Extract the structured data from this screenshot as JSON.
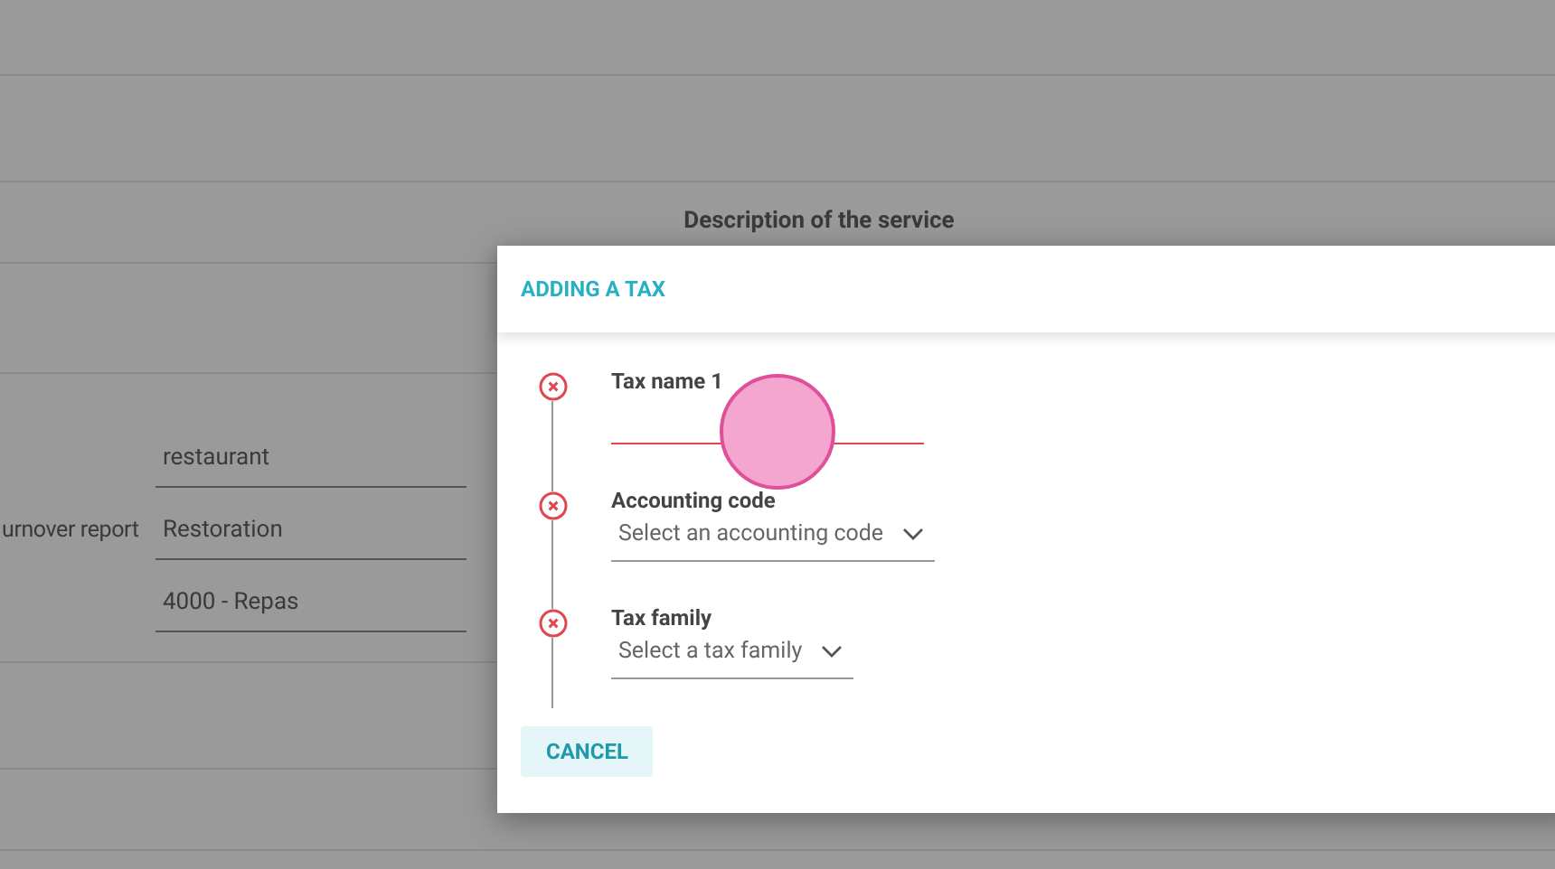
{
  "background": {
    "column_header": "Description of the service",
    "fields": [
      {
        "value": "restaurant"
      },
      {
        "label": "urnover report",
        "value": "Restoration"
      },
      {
        "value": "4000 - Repas"
      }
    ]
  },
  "dialog": {
    "title": "ADDING A TAX",
    "steps": [
      {
        "kind": "text",
        "label": "Tax name 1",
        "error": true,
        "active": true
      },
      {
        "kind": "select",
        "label": "Accounting code",
        "placeholder": "Select an accounting code",
        "error": true
      },
      {
        "kind": "select",
        "label": "Tax family",
        "placeholder": "Select a tax family",
        "error": true
      }
    ],
    "cancel": "CANCEL"
  }
}
